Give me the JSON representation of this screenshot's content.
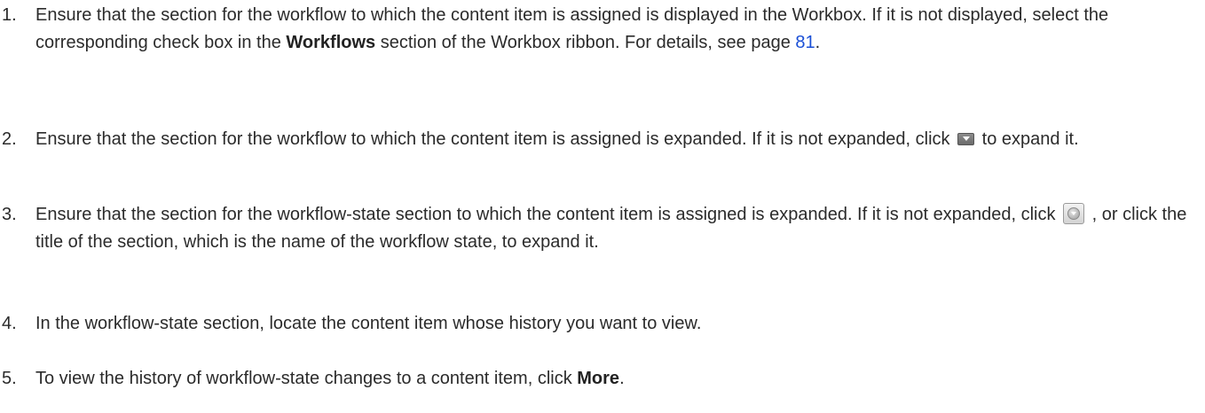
{
  "steps": [
    {
      "num": "1.",
      "a": "Ensure that the section for the workflow to which the content item is assigned is displayed in the Workbox. If it is not displayed, select the corresponding check box in the ",
      "b": "Workflows",
      "c": " section of the Workbox ribbon. For details, see page ",
      "link": "81",
      "d": "."
    },
    {
      "num": "2.",
      "a": "Ensure that the section for the workflow to which the content item is assigned is expanded. If it is not expanded, click ",
      "icon": "expand-triangle-icon",
      "b": " to expand it."
    },
    {
      "num": "3.",
      "a": "Ensure that the section for the workflow-state section to which the content item is assigned is expanded. If it is not expanded, click ",
      "icon": "expand-circle-icon",
      "b": " , or click the title of the section, which is the name of the workflow state, to expand it."
    },
    {
      "num": "4.",
      "a": "In the workflow-state section, locate the content item whose history you want to view."
    },
    {
      "num": "5.",
      "a": "To view the history of workflow-state changes to a content item, click ",
      "b": "More",
      "c": "."
    }
  ]
}
